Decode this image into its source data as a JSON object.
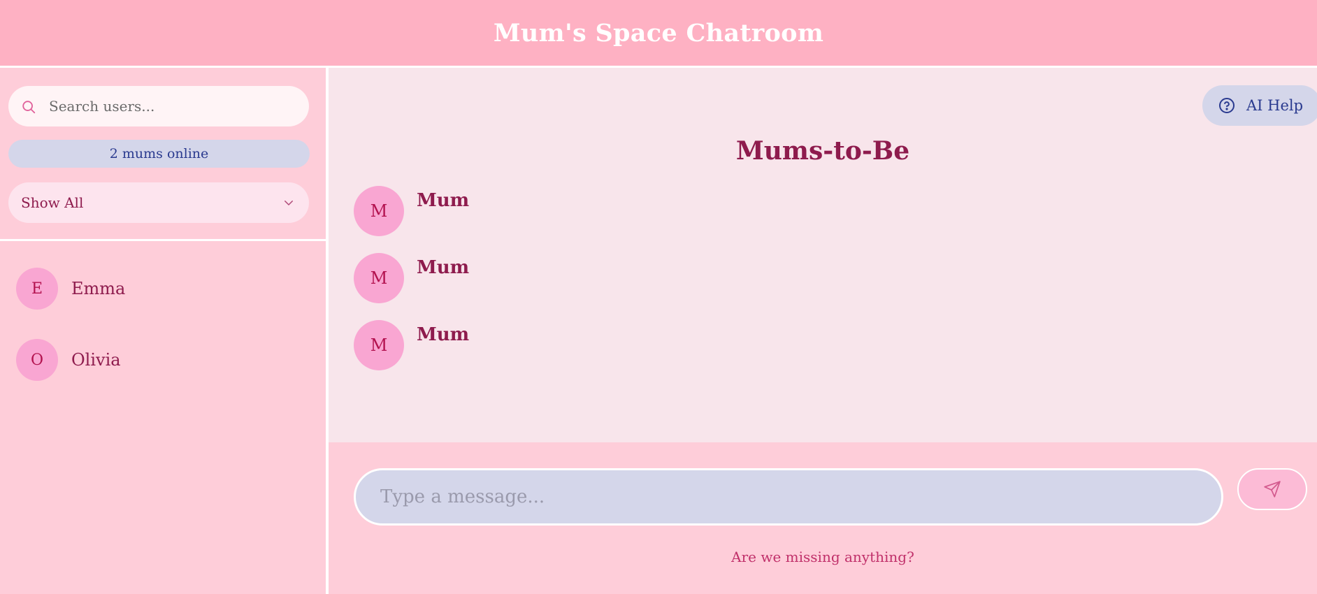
{
  "app": {
    "title": "Mum's Space Chatroom"
  },
  "sidebar": {
    "search": {
      "placeholder": "Search users...",
      "icon": "search-icon"
    },
    "online_status": "2 mums online",
    "filter": {
      "selected": "Show All",
      "icon": "chevron-down-icon"
    },
    "users": [
      {
        "initial": "E",
        "name": "Emma"
      },
      {
        "initial": "O",
        "name": "Olivia"
      }
    ]
  },
  "main": {
    "ai_help": {
      "label": "AI Help",
      "icon": "help-circle-icon"
    },
    "room_title": "Mums-to-Be",
    "messages": [
      {
        "initial": "M",
        "author": "Mum"
      },
      {
        "initial": "M",
        "author": "Mum"
      },
      {
        "initial": "M",
        "author": "Mum"
      }
    ]
  },
  "composer": {
    "placeholder": "Type a message...",
    "send_icon": "send-icon",
    "feedback_link": "Are we missing anything?"
  },
  "colors": {
    "header": "#feb1c3",
    "background": "#fecdd9",
    "chat_area": "#f8e5eb",
    "accent_text": "#8e1b4d",
    "avatar": "#f9a6d2",
    "blue_chip": "#d4d6ea"
  }
}
